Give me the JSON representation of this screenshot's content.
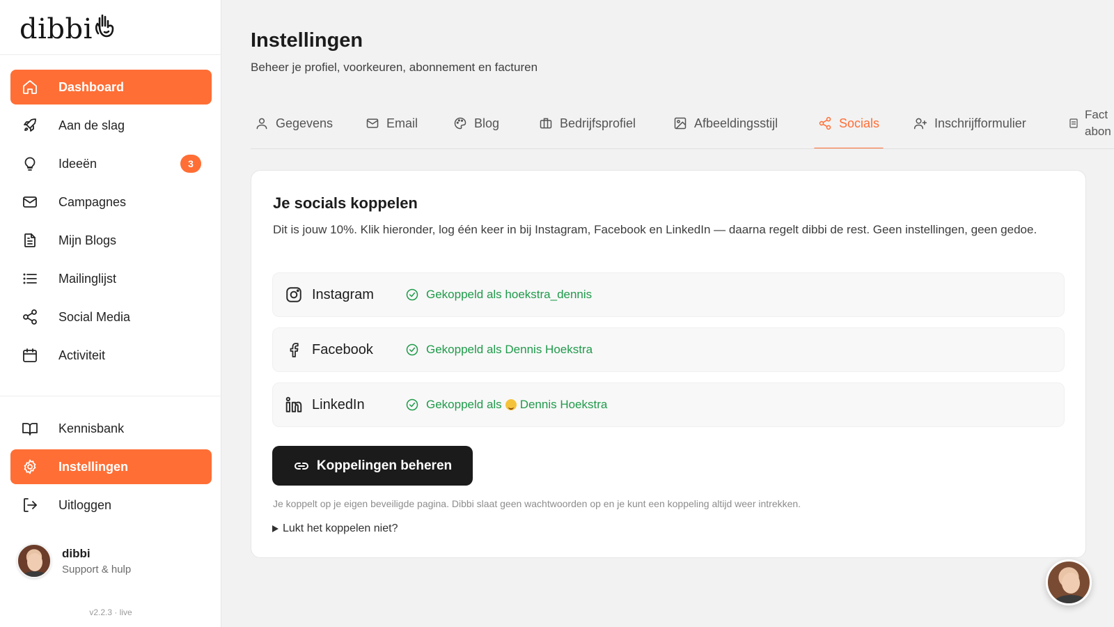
{
  "app": {
    "logo_text": "dibbi"
  },
  "sidebar": {
    "items": [
      {
        "label": "Dashboard",
        "icon": "home-icon",
        "active": true
      },
      {
        "label": "Aan de slag",
        "icon": "rocket-icon"
      },
      {
        "label": "Ideeën",
        "icon": "lightbulb-icon",
        "badge": "3"
      },
      {
        "label": "Campagnes",
        "icon": "mail-icon"
      },
      {
        "label": "Mijn Blogs",
        "icon": "document-icon"
      },
      {
        "label": "Mailinglijst",
        "icon": "list-icon"
      },
      {
        "label": "Social Media",
        "icon": "share-icon"
      },
      {
        "label": "Activiteit",
        "icon": "calendar-icon"
      }
    ],
    "bottom_items": [
      {
        "label": "Kennisbank",
        "icon": "book-icon"
      },
      {
        "label": "Instellingen",
        "icon": "gear-icon",
        "active": true
      },
      {
        "label": "Uitloggen",
        "icon": "logout-icon"
      }
    ],
    "support": {
      "name": "dibbi",
      "subtitle": "Support & hulp"
    },
    "version": "v2.2.3 · live"
  },
  "page": {
    "title": "Instellingen",
    "subtitle": "Beheer je profiel, voorkeuren, abonnement en facturen"
  },
  "tabs": [
    {
      "label": "Gegevens",
      "icon": "user-icon"
    },
    {
      "label": "Email",
      "icon": "mail-icon"
    },
    {
      "label": "Blog",
      "icon": "palette-icon"
    },
    {
      "label": "Bedrijfsprofiel",
      "icon": "briefcase-icon"
    },
    {
      "label": "Afbeeldingsstijl",
      "icon": "image-icon"
    },
    {
      "label": "Socials",
      "icon": "share-icon",
      "active": true
    },
    {
      "label": "Inschrijfformulier",
      "icon": "user-plus-icon"
    },
    {
      "label_line1": "Fact",
      "label_line2": "abon",
      "icon": "receipt-icon"
    }
  ],
  "socials_card": {
    "title": "Je socials koppelen",
    "description": "Dit is jouw 10%. Klik hieronder, log één keer in bij Instagram, Facebook en LinkedIn — daarna regelt dibbi de rest. Geen instellingen, geen gedoe.",
    "rows": [
      {
        "name": "Instagram",
        "icon": "instagram-icon",
        "status": "Gekoppeld als hoekstra_dennis"
      },
      {
        "name": "Facebook",
        "icon": "facebook-icon",
        "status": "Gekoppeld als Dennis Hoekstra"
      },
      {
        "name": "LinkedIn",
        "icon": "linkedin-icon",
        "status_prefix": "Gekoppeld als",
        "status_suffix": "Dennis Hoekstra"
      }
    ],
    "manage_button": "Koppelingen beheren",
    "note": "Je koppelt op je eigen beveiligde pagina. Dibbi slaat geen wachtwoorden op en je kunt een koppeling altijd weer intrekken.",
    "help_toggle": "Lukt het koppelen niet?"
  },
  "colors": {
    "accent": "#ff6e35",
    "success": "#1f9a4a",
    "dark_button": "#1b1b1b"
  }
}
